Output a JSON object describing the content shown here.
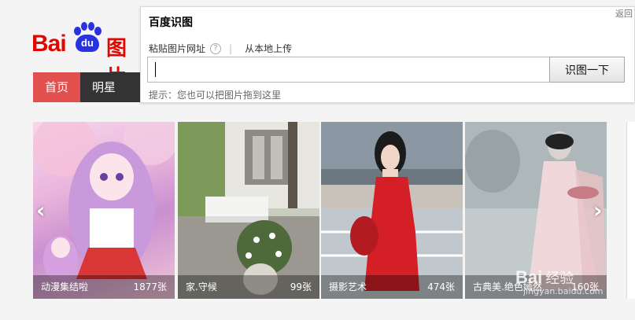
{
  "logo": {
    "bai": "Bai",
    "du": "du",
    "tu": "图片"
  },
  "nav": {
    "items": [
      {
        "label": "首页"
      },
      {
        "label": "明星"
      }
    ]
  },
  "gallery": {
    "cards": [
      {
        "title": "动漫集结啦",
        "count": "1877张"
      },
      {
        "title": "家.守候",
        "count": "99张"
      },
      {
        "title": "摄影艺术",
        "count": "474张"
      },
      {
        "title": "古典美.绝色嫣然",
        "count": "160张"
      }
    ],
    "prev_arrow": "‹",
    "next_arrow": "›"
  },
  "watermark": {
    "logo": "Bai",
    "text": "经验",
    "url": "jingyan.baidu.com"
  },
  "popup": {
    "title": "百度识图",
    "back_label": "返回",
    "paste_tab": "粘贴图片网址",
    "help": "?",
    "separator": "|",
    "upload_tab": "从本地上传",
    "url_value": "",
    "search_button": "识图一下",
    "hint": "提示：您也可以把图片拖到这里"
  },
  "colors": {
    "brand_red": "#e10602",
    "brand_blue": "#2932e1",
    "nav_active": "#e14f4f",
    "nav_bg": "#333333"
  }
}
